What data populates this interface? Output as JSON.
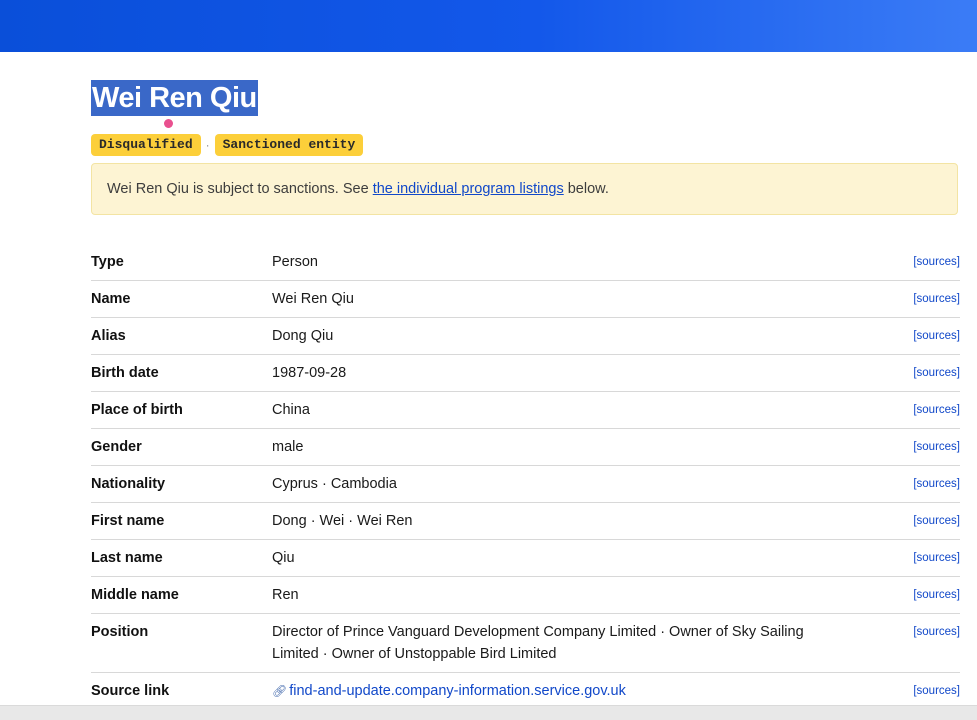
{
  "entity": {
    "title": "Wei Ren Qiu",
    "badges": [
      "Disqualified",
      "Sanctioned entity"
    ],
    "badge_separator": "·"
  },
  "notice": {
    "text_before": "Wei Ren Qiu is subject to sanctions. See ",
    "link_text": "the individual program listings",
    "text_after": " below."
  },
  "properties": [
    {
      "key": "Type",
      "value": "Person",
      "sources": "[sources]"
    },
    {
      "key": "Name",
      "value": "Wei Ren Qiu",
      "sources": "[sources]"
    },
    {
      "key": "Alias",
      "value": "Dong Qiu",
      "sources": "[sources]"
    },
    {
      "key": "Birth date",
      "value": "1987-09-28",
      "sources": "[sources]"
    },
    {
      "key": "Place of birth",
      "value": "China",
      "sources": "[sources]"
    },
    {
      "key": "Gender",
      "value": "male",
      "sources": "[sources]"
    },
    {
      "key": "Nationality",
      "value": "Cyprus · Cambodia",
      "sources": "[sources]"
    },
    {
      "key": "First name",
      "value": "Dong · Wei · Wei Ren",
      "sources": "[sources]"
    },
    {
      "key": "Last name",
      "value": "Qiu",
      "sources": "[sources]"
    },
    {
      "key": "Middle name",
      "value": "Ren",
      "sources": "[sources]"
    },
    {
      "key": "Position",
      "value": "Director of Prince Vanguard Development Company Limited · Owner of Sky Sailing Limited · Owner of Unstoppable Bird Limited",
      "sources": "[sources]"
    },
    {
      "key": "Source link",
      "value": "find-and-update.company-information.service.gov.uk",
      "sources": "[sources]",
      "icon": "link-icon"
    }
  ],
  "colors": {
    "header_blue": "#1358ea",
    "badge_yellow": "#fccf3a",
    "notice_bg": "#fdf4d3",
    "link_blue": "#1148c9",
    "title_highlight": "#3a68c8"
  }
}
